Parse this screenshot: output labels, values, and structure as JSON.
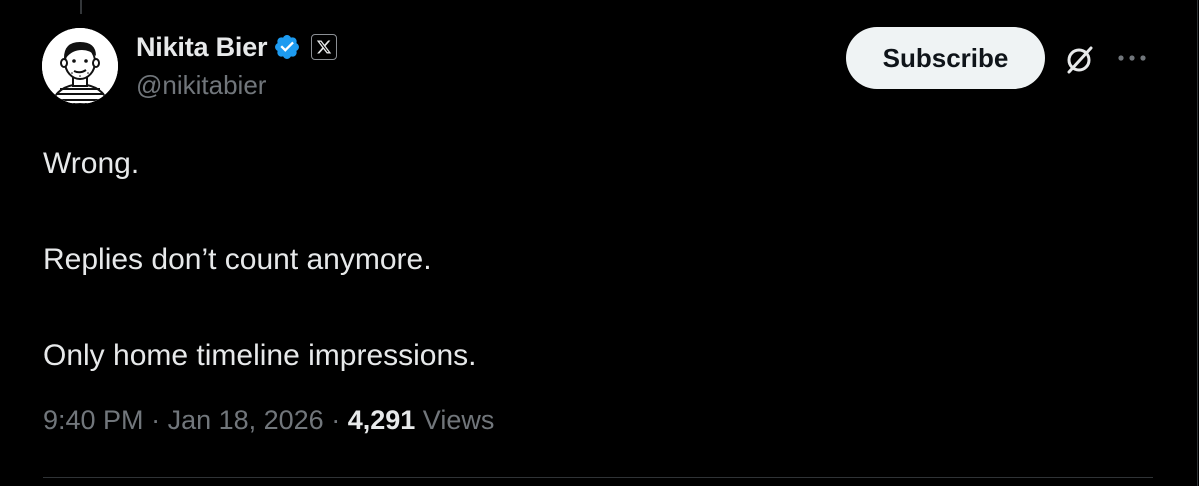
{
  "author": {
    "display_name": "Nikita Bier",
    "handle": "@nikitabier",
    "verified_icon": "verified-badge-icon",
    "affiliation_icon": "x-logo-icon",
    "avatar": "cartoon-avatar"
  },
  "actions": {
    "subscribe_label": "Subscribe",
    "grok_icon": "grok-icon",
    "more_icon": "more-icon"
  },
  "tweet": {
    "lines": [
      "Wrong.",
      "Replies don’t count anymore.",
      "Only home timeline impressions."
    ]
  },
  "meta": {
    "time": "9:40 PM",
    "separator": " · ",
    "date": "Jan 18, 2026",
    "views_count": "4,291",
    "views_label": "Views"
  },
  "colors": {
    "background": "#000000",
    "text": "#e7e9ea",
    "secondary": "#71767b",
    "verified": "#1d9bf0",
    "button_bg": "#eff3f4"
  }
}
